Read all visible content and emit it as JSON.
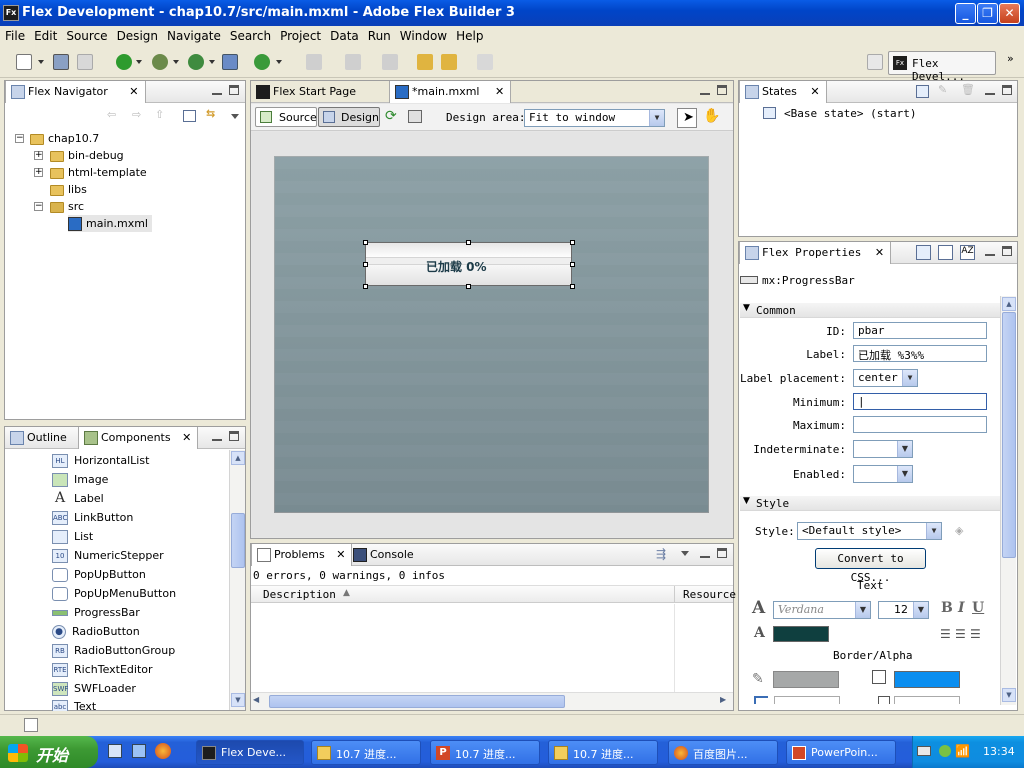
{
  "window": {
    "title": "Flex Development - chap10.7/src/main.mxml - Adobe Flex Builder 3",
    "app_icon": "Fx"
  },
  "menu": [
    "File",
    "Edit",
    "Source",
    "Design",
    "Navigate",
    "Search",
    "Project",
    "Data",
    "Run",
    "Window",
    "Help"
  ],
  "perspective": {
    "label": "Flex Devel..."
  },
  "navigator": {
    "tab_label": "Flex Navigator",
    "project": "chap10.7",
    "folders": [
      "bin-debug",
      "html-template",
      "libs",
      "src"
    ],
    "selected_file": "main.mxml"
  },
  "components_panel": {
    "tabs": [
      "Outline",
      "Components"
    ],
    "items": [
      "HorizontalList",
      "Image",
      "Label",
      "LinkButton",
      "List",
      "NumericStepper",
      "PopUpButton",
      "PopUpMenuButton",
      "ProgressBar",
      "RadioButton",
      "RadioButtonGroup",
      "RichTextEditor",
      "SWFLoader",
      "Text"
    ],
    "icon_labels": [
      "HL",
      "IMG",
      "A",
      "ABC",
      "LST",
      "10",
      "",
      "",
      "",
      "●",
      "RB",
      "RTE",
      "SWF",
      "abc"
    ]
  },
  "editor": {
    "tabs": [
      "Flex Start Page",
      "*main.mxml"
    ],
    "source_label": "Source",
    "design_label": "Design",
    "design_area_label": "Design area:",
    "design_area_value": "Fit to window",
    "progress_label": "已加载 0%"
  },
  "problems": {
    "tabs": [
      "Problems",
      "Console"
    ],
    "summary": "0 errors, 0 warnings, 0 infos",
    "columns": [
      "Description",
      "Resource"
    ]
  },
  "states": {
    "tab_label": "States",
    "item": "<Base state> (start)"
  },
  "properties": {
    "tab_label": "Flex Properties",
    "component": "mx:ProgressBar",
    "common_section": "Common",
    "id_label": "ID:",
    "id_value": "pbar",
    "label_label": "Label:",
    "label_value": "已加载 %3%%",
    "placement_label": "Label placement:",
    "placement_value": "center",
    "minimum_label": "Minimum:",
    "minimum_value": "|",
    "maximum_label": "Maximum:",
    "maximum_value": "",
    "indeterminate_label": "Indeterminate:",
    "enabled_label": "Enabled:",
    "style_section": "Style",
    "style_label": "Style:",
    "style_value": "<Default style>",
    "convert_button": "Convert to CSS...",
    "text_group": "Text",
    "font_family": "Verdana",
    "font_size": "12",
    "bold": "B",
    "italic": "I",
    "underline": "U",
    "text_color": "#0f3f3f",
    "border_group": "Border/Alpha",
    "border_color": "#a6a8a8",
    "fill_color": "#0a8ef0"
  },
  "taskbar": {
    "start_label": "开始",
    "tasks": [
      "Flex Deve...",
      "10.7 进度...",
      "10.7 进度...",
      "10.7 进度...",
      "百度图片...",
      "PowerPoin..."
    ],
    "clock": "13:34"
  }
}
